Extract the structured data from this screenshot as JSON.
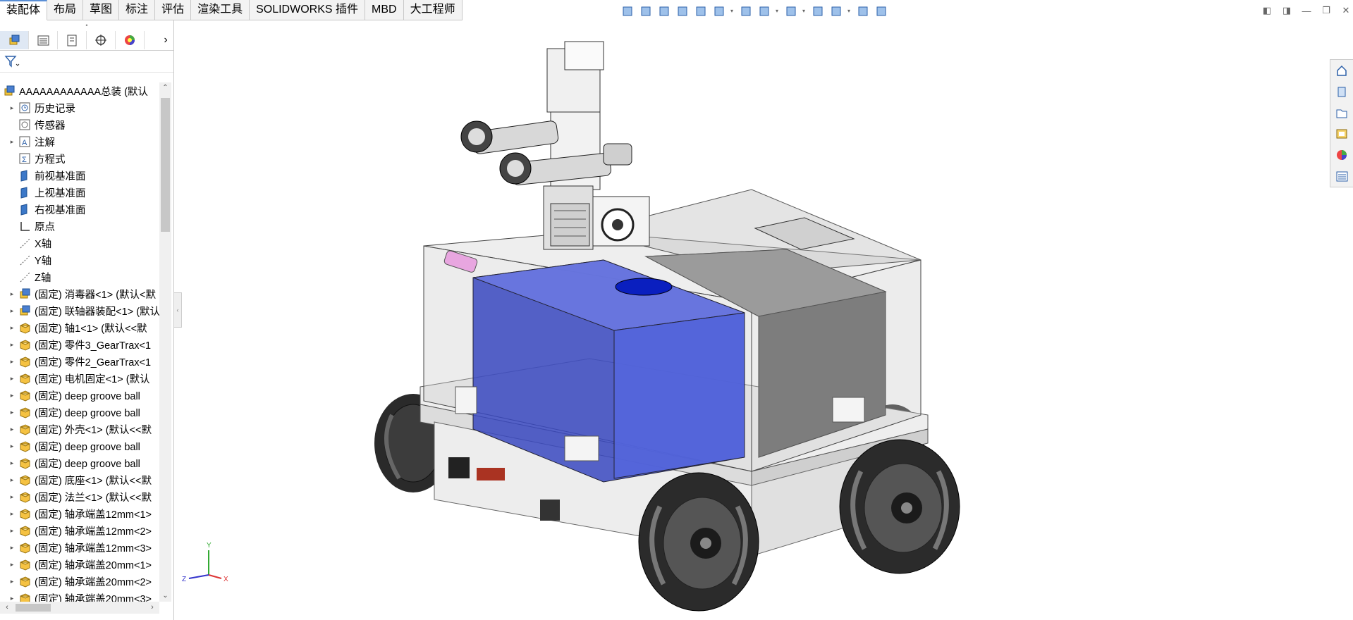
{
  "command_tabs": [
    {
      "label": "装配体",
      "active": true
    },
    {
      "label": "布局"
    },
    {
      "label": "草图"
    },
    {
      "label": "标注"
    },
    {
      "label": "评估"
    },
    {
      "label": "渲染工具"
    },
    {
      "label": "SOLIDWORKS 插件"
    },
    {
      "label": "MBD"
    },
    {
      "label": "大工程师"
    }
  ],
  "heads_up_toolbar": [
    "view-orientation-icon",
    "zoom-to-fit-icon",
    "zoom-to-area-icon",
    "previous-view-icon",
    "section-view-icon",
    "dynamic-annotation-icon",
    "view-orientation-box-icon",
    "display-style-icon",
    "hide-show-icon",
    "edit-appearance-icon",
    "apply-scene-icon",
    "view-settings-icon",
    "display-pane-icon"
  ],
  "panel_tabs": [
    "featuremanager-tree-icon",
    "propertymanager-icon",
    "configurationmanager-icon",
    "dimxpertmanager-icon",
    "displaymanager-icon"
  ],
  "tree": {
    "root": "AAAAAAAAAAAA总装  (默认",
    "items": [
      {
        "label": "历史记录",
        "expand": true,
        "icon": "history-icon"
      },
      {
        "label": "传感器",
        "expand": false,
        "icon": "sensor-icon"
      },
      {
        "label": "注解",
        "expand": true,
        "icon": "annotation-icon"
      },
      {
        "label": "方程式",
        "expand": false,
        "icon": "equation-icon"
      },
      {
        "label": "前视基准面",
        "expand": false,
        "icon": "plane-icon"
      },
      {
        "label": "上视基准面",
        "expand": false,
        "icon": "plane-icon"
      },
      {
        "label": "右视基准面",
        "expand": false,
        "icon": "plane-icon"
      },
      {
        "label": "原点",
        "expand": false,
        "icon": "origin-icon"
      },
      {
        "label": "X轴",
        "expand": false,
        "icon": "axis-icon"
      },
      {
        "label": "Y轴",
        "expand": false,
        "icon": "axis-icon"
      },
      {
        "label": "Z轴",
        "expand": false,
        "icon": "axis-icon"
      },
      {
        "label": "(固定) 消毒器<1> (默认<默",
        "expand": true,
        "icon": "subassembly-icon"
      },
      {
        "label": "(固定) 联轴器装配<1> (默认",
        "expand": true,
        "icon": "subassembly-icon"
      },
      {
        "label": "(固定) 轴1<1> (默认<<默",
        "expand": true,
        "icon": "part-icon"
      },
      {
        "label": "(固定) 零件3_GearTrax<1",
        "expand": true,
        "icon": "part-icon"
      },
      {
        "label": "(固定) 零件2_GearTrax<1",
        "expand": true,
        "icon": "part-icon"
      },
      {
        "label": "(固定) 电机固定<1> (默认",
        "expand": true,
        "icon": "part-icon"
      },
      {
        "label": "(固定) deep groove ball",
        "expand": true,
        "icon": "part-icon"
      },
      {
        "label": "(固定) deep groove ball",
        "expand": true,
        "icon": "part-icon"
      },
      {
        "label": "(固定) 外壳<1> (默认<<默",
        "expand": true,
        "icon": "part-icon"
      },
      {
        "label": "(固定) deep groove ball",
        "expand": true,
        "icon": "part-icon"
      },
      {
        "label": "(固定) deep groove ball",
        "expand": true,
        "icon": "part-icon"
      },
      {
        "label": "(固定) 底座<1> (默认<<默",
        "expand": true,
        "icon": "part-icon"
      },
      {
        "label": "(固定) 法兰<1> (默认<<默",
        "expand": true,
        "icon": "part-icon"
      },
      {
        "label": "(固定) 轴承端盖12mm<1>",
        "expand": true,
        "icon": "part-icon"
      },
      {
        "label": "(固定) 轴承端盖12mm<2>",
        "expand": true,
        "icon": "part-icon"
      },
      {
        "label": "(固定) 轴承端盖12mm<3>",
        "expand": true,
        "icon": "part-icon"
      },
      {
        "label": "(固定) 轴承端盖20mm<1>",
        "expand": true,
        "icon": "part-icon"
      },
      {
        "label": "(固定) 轴承端盖20mm<2>",
        "expand": true,
        "icon": "part-icon"
      },
      {
        "label": "(固定) 轴承端盖20mm<3>",
        "expand": true,
        "icon": "part-icon"
      }
    ]
  },
  "triad": {
    "x": "X",
    "y": "Y",
    "z": "Z"
  },
  "taskpane": [
    "solidworks-resources-icon",
    "design-library-icon",
    "file-explorer-icon",
    "view-palette-icon",
    "appearances-icon",
    "custom-properties-icon"
  ],
  "colors": {
    "tank_blue": "#5566dd",
    "housing_gray": "#8a8a8a",
    "accent": "#5a8fd6"
  }
}
